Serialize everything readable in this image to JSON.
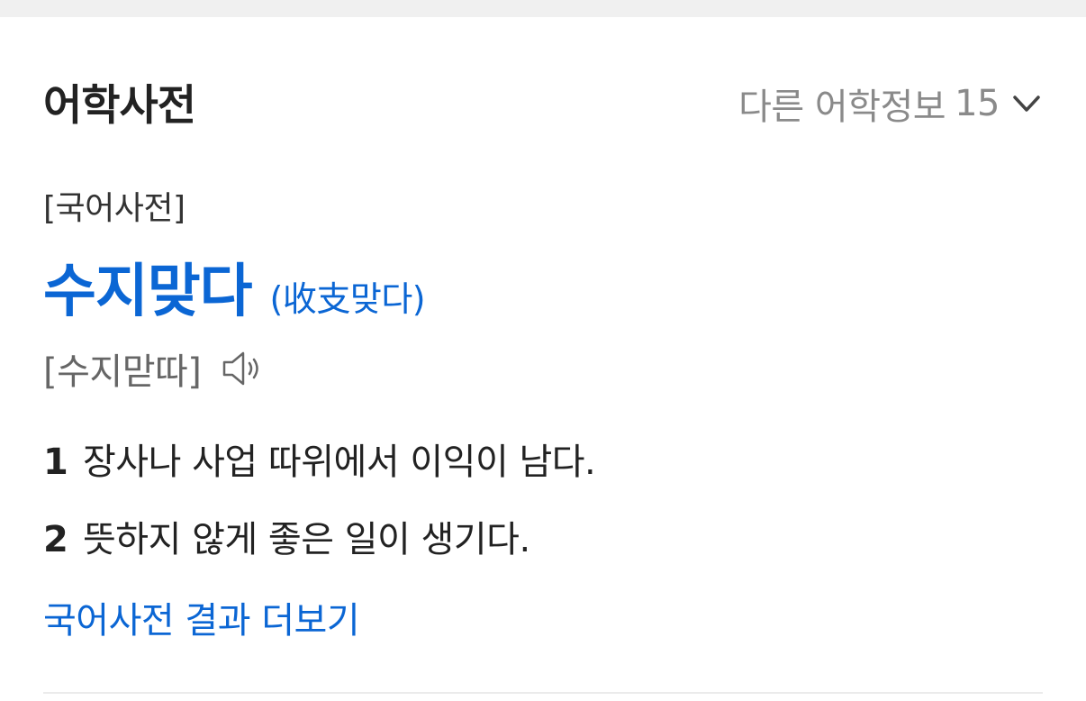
{
  "header": {
    "title": "어학사전",
    "more_info_label": "다른 어학정보",
    "more_info_count": "15",
    "more_info_icon": "chevron-down-icon"
  },
  "entry": {
    "source": "[국어사전]",
    "headword": "수지맞다",
    "hanja": "(收支맞다)",
    "pronunciation": "[수지맏따]",
    "audio_icon": "speaker-icon",
    "definitions": [
      {
        "num": "1",
        "text": "장사나 사업 따위에서 이익이 남다."
      },
      {
        "num": "2",
        "text": "뜻하지 않게 좋은 일이 생기다."
      }
    ]
  },
  "footer": {
    "more_results": "국어사전 결과 더보기"
  },
  "colors": {
    "accent": "#0b66d4",
    "muted": "#8a8a8a"
  }
}
